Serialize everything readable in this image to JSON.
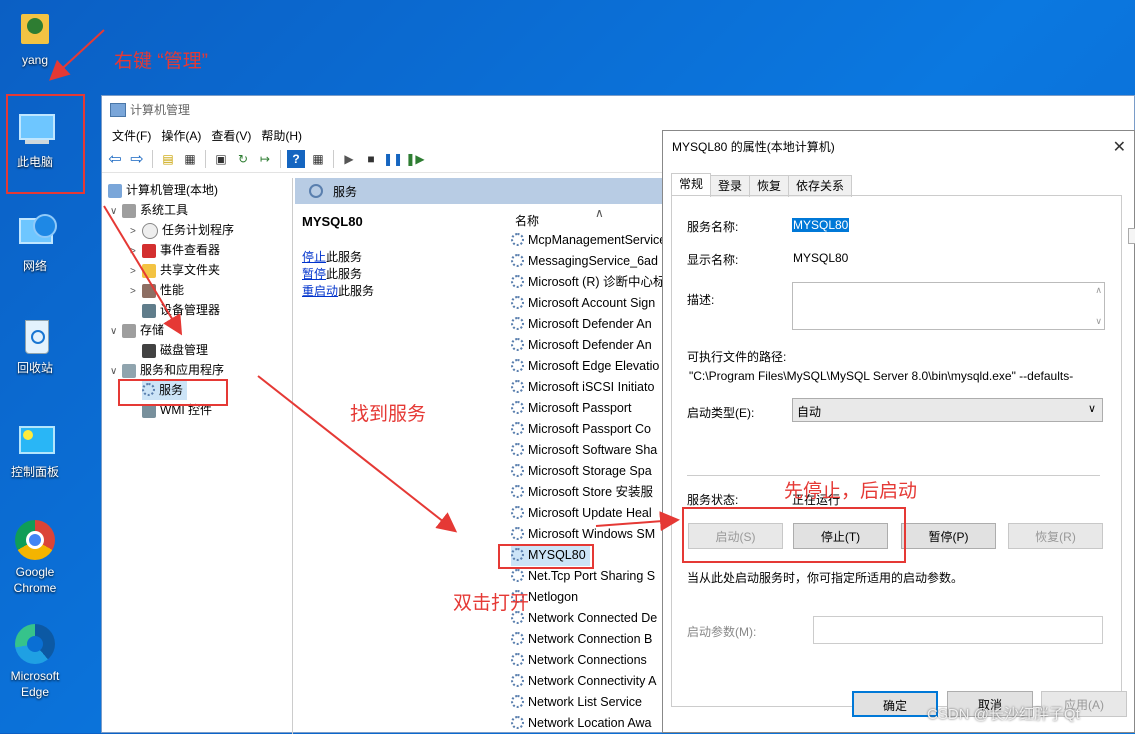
{
  "desktop": {
    "icons": [
      {
        "label": "yang"
      },
      {
        "label": "此电脑"
      },
      {
        "label": "网络"
      },
      {
        "label": "回收站"
      },
      {
        "label": "控制面板"
      },
      {
        "label": "Google Chrome"
      },
      {
        "label": "Microsoft Edge"
      }
    ]
  },
  "mmc": {
    "title": "计算机管理",
    "menu": [
      "文件(F)",
      "操作(A)",
      "查看(V)",
      "帮助(H)"
    ],
    "tree": {
      "root": "计算机管理(本地)",
      "system_tools": "系统工具",
      "task_scheduler": "任务计划程序",
      "event_viewer": "事件查看器",
      "shared_folders": "共享文件夹",
      "performance": "性能",
      "device_manager": "设备管理器",
      "storage": "存储",
      "disk_management": "磁盘管理",
      "services_apps": "服务和应用程序",
      "services": "服务",
      "wmi": "WMI 控件"
    },
    "panel_header": "服务",
    "selected_service": "MYSQL80",
    "actions": [
      {
        "link": "停止",
        "rest": "此服务"
      },
      {
        "link": "暂停",
        "rest": "此服务"
      },
      {
        "link": "重启动",
        "rest": "此服务"
      }
    ],
    "column_name": "名称",
    "services": [
      "McpManagementService",
      "MessagingService_6ad",
      "Microsoft (R) 诊断中心标",
      "Microsoft Account Sign",
      "Microsoft Defender An",
      "Microsoft Defender An",
      "Microsoft Edge Elevatio",
      "Microsoft iSCSI Initiato",
      "Microsoft Passport",
      "Microsoft Passport Co",
      "Microsoft Software Sha",
      "Microsoft Storage Spa",
      "Microsoft Store 安装服",
      "Microsoft Update Heal",
      "Microsoft Windows SM",
      "MYSQL80",
      "Net.Tcp Port Sharing S",
      "Netlogon",
      "Network Connected De",
      "Network Connection B",
      "Network Connections",
      "Network Connectivity A",
      "Network List Service",
      "Network Location Awa"
    ]
  },
  "dialog": {
    "title": "MYSQL80 的属性(本地计算机)",
    "tabs": [
      "常规",
      "登录",
      "恢复",
      "依存关系"
    ],
    "service_name_label": "服务名称:",
    "service_name": "MYSQL80",
    "display_name_label": "显示名称:",
    "display_name": "MYSQL80",
    "description_label": "描述:",
    "path_label": "可执行文件的路径:",
    "path": "\"C:\\Program Files\\MySQL\\MySQL Server 8.0\\bin\\mysqld.exe\" --defaults-",
    "startup_type_label": "启动类型(E):",
    "startup_type": "自动",
    "status_label": "服务状态:",
    "status": "正在运行",
    "btn_start": "启动(S)",
    "btn_stop": "停止(T)",
    "btn_pause": "暂停(P)",
    "btn_resume": "恢复(R)",
    "hint": "当从此处启动服务时，你可指定所适用的启动参数。",
    "params_label": "启动参数(M):",
    "btn_ok": "确定",
    "btn_cancel": "取消",
    "btn_apply": "应用(A)"
  },
  "annotations": {
    "right_click": "右键 “管理”",
    "find_services": "找到服务",
    "double_click": "双击打开",
    "stop_then_start": "先停止，后启动"
  },
  "watermark": "CSDN @长沙红胖子Qt",
  "colors": {
    "annotation_red": "#e53935",
    "desktop_blue": "#0a6fd4",
    "selection_blue": "#0078d7",
    "panel_header": "#b8cce4"
  }
}
